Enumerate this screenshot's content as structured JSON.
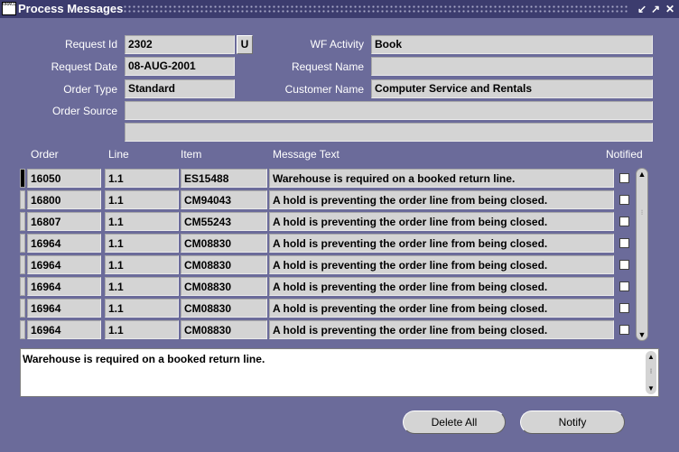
{
  "window": {
    "title": "Process Messages",
    "icon_text": "ORACLE",
    "controls": [
      "↙",
      "↗",
      "✕"
    ]
  },
  "header": {
    "request_id_label": "Request Id",
    "request_id": "2302",
    "u_button": "U",
    "request_date_label": "Request Date",
    "request_date": "08-AUG-2001",
    "order_type_label": "Order Type",
    "order_type": "Standard",
    "order_source_label": "Order Source",
    "order_source": "",
    "order_source_2": "",
    "wf_activity_label": "WF Activity",
    "wf_activity": "Book",
    "request_name_label": "Request Name",
    "request_name": "",
    "customer_name_label": "Customer Name",
    "customer_name": "Computer Service and Rentals"
  },
  "table": {
    "columns": [
      "Order",
      "Line",
      "Item",
      "Message Text",
      "Notified"
    ],
    "rows": [
      {
        "order": "16050",
        "line": "1.1",
        "item": "ES15488",
        "message": "Warehouse is required on a booked return line.",
        "notified": false
      },
      {
        "order": "16800",
        "line": "1.1",
        "item": "CM94043",
        "message": "A hold is preventing the order line from being closed.",
        "notified": false
      },
      {
        "order": "16807",
        "line": "1.1",
        "item": "CM55243",
        "message": "A hold is preventing the order line from being closed.",
        "notified": false
      },
      {
        "order": "16964",
        "line": "1.1",
        "item": "CM08830",
        "message": "A hold is preventing the order line from being closed.",
        "notified": false
      },
      {
        "order": "16964",
        "line": "1.1",
        "item": "CM08830",
        "message": "A hold is preventing the order line from being closed.",
        "notified": false
      },
      {
        "order": "16964",
        "line": "1.1",
        "item": "CM08830",
        "message": "A hold is preventing the order line from being closed.",
        "notified": false
      },
      {
        "order": "16964",
        "line": "1.1",
        "item": "CM08830",
        "message": "A hold is preventing the order line from being closed.",
        "notified": false
      },
      {
        "order": "16964",
        "line": "1.1",
        "item": "CM08830",
        "message": "A hold is preventing the order line from being closed.",
        "notified": false
      }
    ]
  },
  "message_detail": "Warehouse is required on a booked return line.",
  "buttons": {
    "delete_all": "Delete All",
    "notify": "Notify"
  },
  "colors": {
    "background": "#6b6b9a",
    "titlebar": "#3c3c6e",
    "field": "#d4d4d4"
  }
}
